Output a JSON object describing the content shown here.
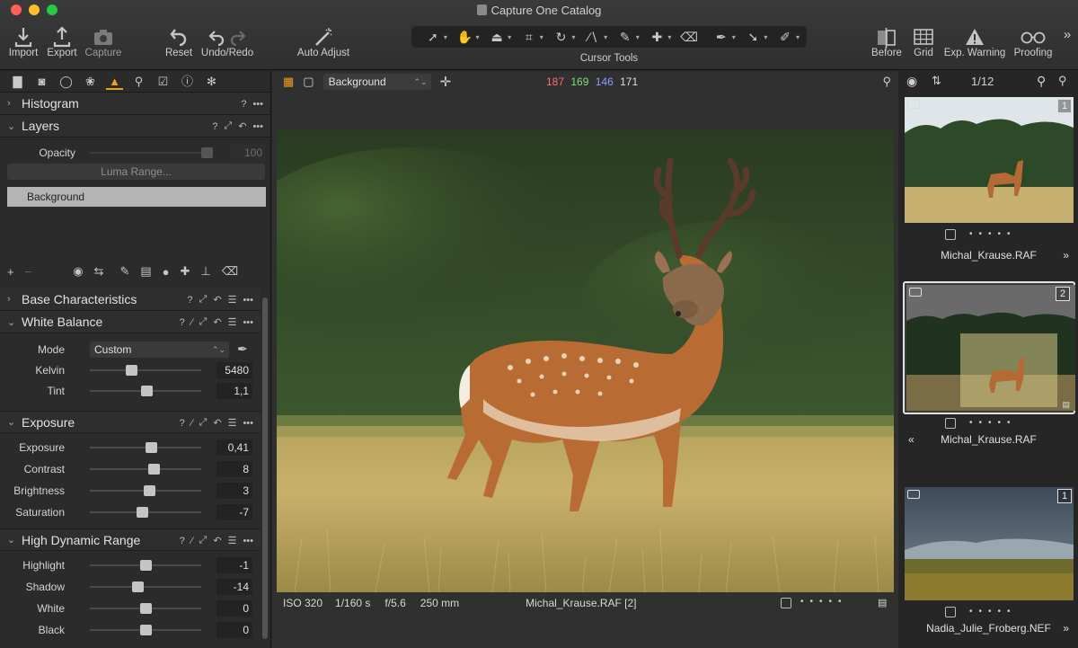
{
  "window": {
    "title": "Capture One Catalog"
  },
  "toolbar": {
    "import": "Import",
    "export": "Export",
    "capture": "Capture",
    "reset": "Reset",
    "undo_redo": "Undo/Redo",
    "auto_adjust": "Auto Adjust",
    "cursor_tools": "Cursor Tools",
    "before": "Before",
    "grid": "Grid",
    "exp_warning": "Exp. Warning",
    "proofing": "Proofing",
    "more": "»"
  },
  "panels": {
    "histogram": "Histogram",
    "layers": {
      "title": "Layers",
      "opacity_label": "Opacity",
      "opacity_value": "100",
      "luma_range": "Luma Range...",
      "layer_name": "Background"
    },
    "base_characteristics": "Base Characteristics",
    "white_balance": {
      "title": "White Balance",
      "mode_label": "Mode",
      "mode_value": "Custom",
      "kelvin_label": "Kelvin",
      "kelvin_value": "5480",
      "tint_label": "Tint",
      "tint_value": "1,1",
      "kelvin_pos": 0.37,
      "tint_pos": 0.51
    },
    "exposure": {
      "title": "Exposure",
      "rows": [
        {
          "label": "Exposure",
          "value": "0,41",
          "pos": 0.55
        },
        {
          "label": "Contrast",
          "value": "8",
          "pos": 0.57
        },
        {
          "label": "Brightness",
          "value": "3",
          "pos": 0.53
        },
        {
          "label": "Saturation",
          "value": "-7",
          "pos": 0.47
        }
      ]
    },
    "hdr": {
      "title": "High Dynamic Range",
      "rows": [
        {
          "label": "Highlight",
          "value": "-1",
          "pos": 0.5
        },
        {
          "label": "Shadow",
          "value": "-14",
          "pos": 0.43
        },
        {
          "label": "White",
          "value": "0",
          "pos": 0.5
        },
        {
          "label": "Black",
          "value": "0",
          "pos": 0.5
        }
      ]
    }
  },
  "viewer": {
    "layer_select": "Background",
    "rgb": {
      "r": "187",
      "g": "169",
      "b": "146",
      "l": "171"
    },
    "iso": "ISO 320",
    "shutter": "1/160 s",
    "aperture": "f/5.6",
    "focal": "250 mm",
    "filename": "Michal_Krause.RAF [2]"
  },
  "browser": {
    "counter": "1/12",
    "items": [
      {
        "name": "Michal_Krause.RAF",
        "badge": "1"
      },
      {
        "name": "Michal_Krause.RAF",
        "badge": "2"
      },
      {
        "name": "Nadia_Julie_Froberg.NEF",
        "badge": "1"
      }
    ]
  },
  "colors": {
    "accent": "#f39d1f",
    "red": "#ff6b6b",
    "green": "#7be07b",
    "blue": "#8c9cff"
  }
}
